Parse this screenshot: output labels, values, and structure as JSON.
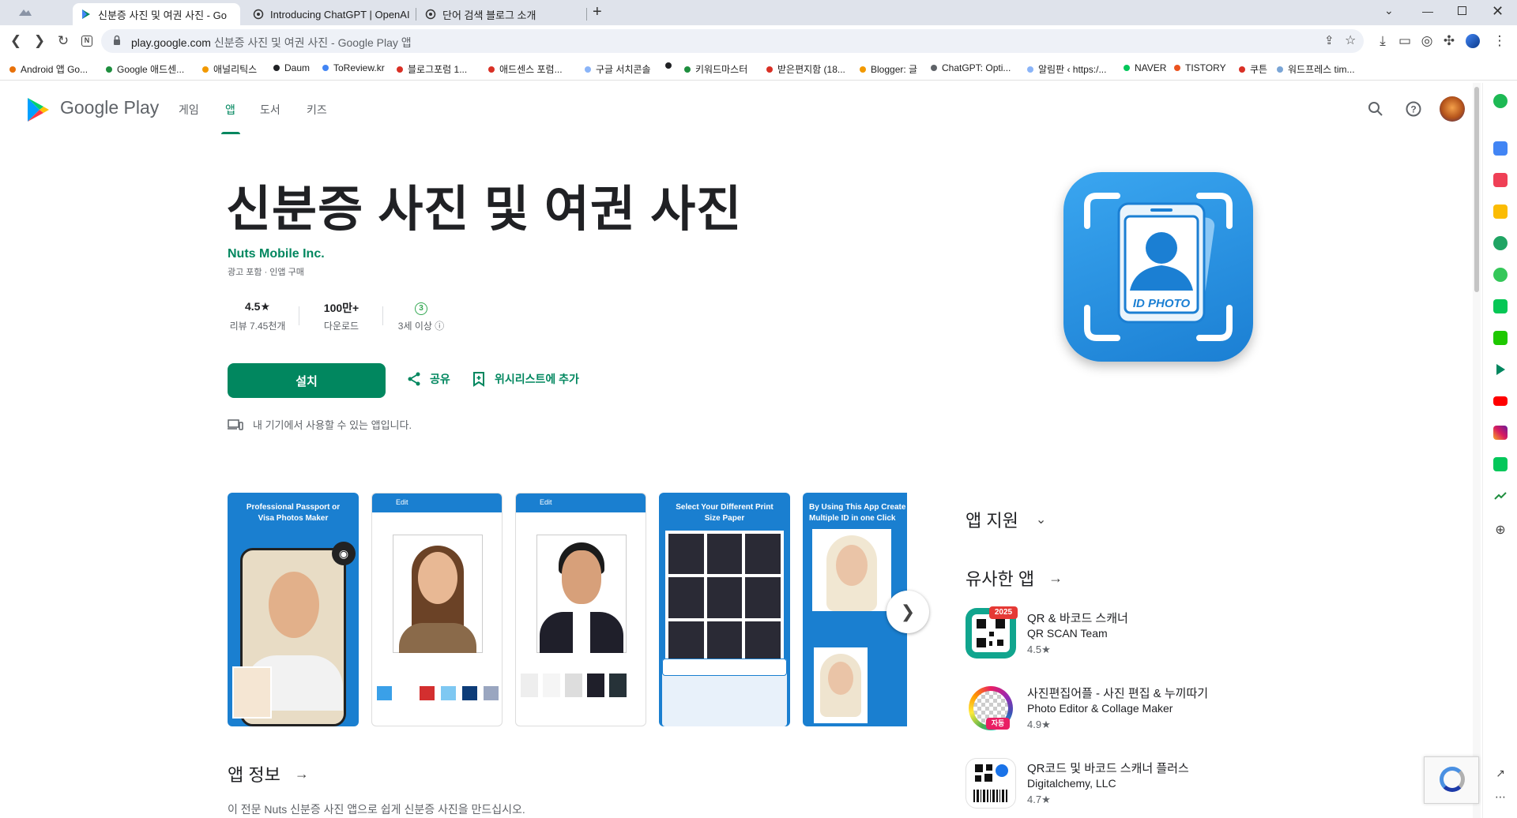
{
  "browser": {
    "tabs": [
      {
        "title": "신분증 사진 및 여권 사진 - Go"
      },
      {
        "title": "Introducing ChatGPT | OpenAI"
      },
      {
        "title": "단어 검색 블로그 소개"
      }
    ],
    "new_tab": "+",
    "url_host": "play.google.com",
    "url_rest": "신분증 사진 및 여권 사진 - Google Play 앱",
    "bookmarks": [
      {
        "label": "Android 앱 Go...",
        "color": "#e8710a"
      },
      {
        "label": "Google 애드센...",
        "color": "#1e8e3e"
      },
      {
        "label": "애널리틱스",
        "color": "#f29900"
      },
      {
        "label": "Daum",
        "color": "#202124"
      },
      {
        "label": "ToReview.kr",
        "color": "#4285f4"
      },
      {
        "label": "블로그포럼 1...",
        "color": "#d93025"
      },
      {
        "label": "애드센스 포럼...",
        "color": "#d93025"
      },
      {
        "label": "구글 서치콘솔",
        "color": "#8ab4f8"
      },
      {
        "label": "",
        "color": "#202124"
      },
      {
        "label": "키워드마스터",
        "color": "#1e8e3e"
      },
      {
        "label": "받은편지함 (18...",
        "color": "#d93025"
      },
      {
        "label": "Blogger: 글",
        "color": "#f29900"
      },
      {
        "label": "ChatGPT: Opti...",
        "color": "#5f6368"
      },
      {
        "label": "알림판 ‹ https:/...",
        "color": "#8ab4f8"
      },
      {
        "label": "NAVER",
        "color": "#03c75a"
      },
      {
        "label": "TISTORY",
        "color": "#eb531f"
      },
      {
        "label": "쿠튼",
        "color": "#d93025"
      },
      {
        "label": "워드프레스 tim...",
        "color": "#7aa5d6"
      }
    ]
  },
  "play": {
    "logo_text": "Google Play",
    "nav": [
      "게임",
      "앱",
      "도서",
      "키즈"
    ],
    "accent": "#01875f"
  },
  "app": {
    "title": "신분증 사진 및 여권 사진",
    "developer": "Nuts Mobile Inc.",
    "ads_note": "광고 포함 · 인앱 구매",
    "rating_value": "4.5★",
    "rating_label": "리뷰 7.45천개",
    "downloads_value": "100만+",
    "downloads_label": "다운로드",
    "age_badge": "3",
    "age_label": "3세 이상 ⓘ",
    "install_label": "설치",
    "share_label": "공유",
    "wishlist_label": "위시리스트에 추가",
    "device_note": "내 기기에서 사용할 수 있는 앱입니다.",
    "icon_text": "ID PHOTO"
  },
  "screenshots": [
    {
      "caption": "Professional Passport or Visa Photos Maker"
    },
    {
      "caption": "Edit"
    },
    {
      "caption": "Edit"
    },
    {
      "caption": "Select Your Different Print Size Paper"
    },
    {
      "caption": "By Using This App Create Multiple ID in one Click"
    }
  ],
  "support": {
    "heading": "앱 지원"
  },
  "similar": {
    "heading": "유사한 앱",
    "apps": [
      {
        "name": "QR & 바코드 스캐너",
        "dev": "QR SCAN Team",
        "rating": "4.5★",
        "badge": "2025"
      },
      {
        "name": "사진편집어플 - 사진 편집 & 누끼따기",
        "dev": "Photo Editor & Collage Maker",
        "rating": "4.9★",
        "badge": "자동"
      },
      {
        "name": "QR코드 및 바코드 스캐너 플러스",
        "dev": "Digitalchemy, LLC",
        "rating": "4.7★",
        "badge": ""
      }
    ]
  },
  "info": {
    "heading": "앱 정보",
    "desc": "이 전문 Nuts 신분증 사진 앱으로 쉽게 신분증 사진을 만드십시오."
  }
}
